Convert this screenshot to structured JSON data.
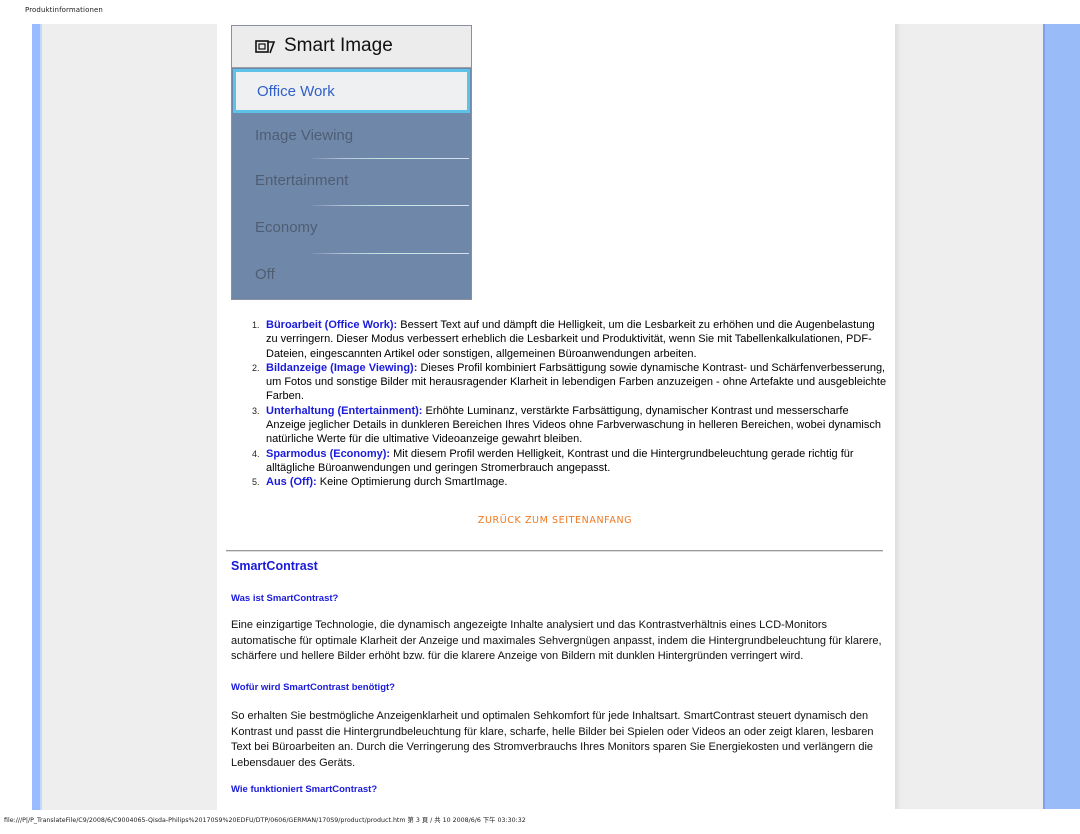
{
  "header": {
    "label": "Produktinformationen"
  },
  "smart_image_menu": {
    "icon": "smart-image-icon",
    "title": "Smart Image",
    "selected": "Office Work",
    "items": [
      "Office Work",
      "Image Viewing",
      "Entertainment",
      "Economy",
      "Off"
    ]
  },
  "modes": [
    {
      "num": "1.",
      "term": "Büroarbeit (Office Work):",
      "text": " Bessert Text auf und dämpft die Helligkeit, um die Lesbarkeit zu erhöhen und die Augenbelastung zu verringern. Dieser Modus verbessert erheblich die Lesbarkeit und Produktivität, wenn Sie mit Tabellenkalkulationen, PDF-Dateien, eingescannten Artikel oder sonstigen, allgemeinen Büroanwendungen arbeiten."
    },
    {
      "num": "2.",
      "term": "Bildanzeige (Image Viewing):",
      "text": " Dieses Profil kombiniert Farbsättigung sowie dynamische Kontrast- und Schärfenverbesserung, um Fotos und sonstige Bilder mit herausragender Klarheit in lebendigen Farben anzuzeigen - ohne Artefakte und ausgebleichte Farben."
    },
    {
      "num": "3.",
      "term": "Unterhaltung (Entertainment):",
      "text": " Erhöhte Luminanz, verstärkte Farbsättigung, dynamischer Kontrast und messerscharfe Anzeige jeglicher Details in dunkleren Bereichen Ihres Videos ohne Farbverwaschung in helleren Bereichen, wobei dynamisch natürliche Werte für die ultimative Videoanzeige gewahrt bleiben."
    },
    {
      "num": "4.",
      "term": "Sparmodus (Economy):",
      "text": " Mit diesem Profil werden Helligkeit, Kontrast und die Hintergrundbeleuchtung gerade richtig für alltägliche Büroanwendungen und geringen Stromerbrauch angepasst."
    },
    {
      "num": "5.",
      "term": "Aus (Off):",
      "text": " Keine Optimierung durch SmartImage."
    }
  ],
  "back_to_top": "ZURÜCK ZUM SEITENANFANG",
  "smart_contrast": {
    "title": "SmartContrast",
    "q1": "Was ist SmartContrast?",
    "p1": "Eine einzigartige Technologie, die dynamisch angezeigte Inhalte analysiert und das Kontrastverhältnis eines LCD-Monitors automatische für optimale Klarheit der Anzeige und maximales Sehvergnügen anpasst, indem die Hintergrundbeleuchtung für klarere, schärfere und hellere Bilder erhöht bzw. für die klarere Anzeige von Bildern mit dunklen Hintergründen verringert wird.",
    "q2": "Wofür wird SmartContrast benötigt?",
    "p2": "So erhalten Sie bestmögliche Anzeigenklarheit und optimalen Sehkomfort für jede Inhaltsart. SmartContrast steuert dynamisch den Kontrast und passt die Hintergrundbeleuchtung für klare, scharfe, helle Bilder bei Spielen oder Videos an oder zeigt klaren, lesbaren Text bei Büroarbeiten an. Durch die Verringerung des Stromverbrauchs Ihres Monitors sparen Sie Energiekosten und verlängern die Lebensdauer des Geräts.",
    "q3": "Wie funktioniert SmartContrast?"
  },
  "footer": "file:///P|/P_TranslateFile/C9/2008/6/C9004065-Qisda-Philips%20170S9%20EDFU/DTP/0606/GERMAN/170S9/product/product.htm 第 3 頁 / 共 10 2008/6/6 下午 03:30:32"
}
